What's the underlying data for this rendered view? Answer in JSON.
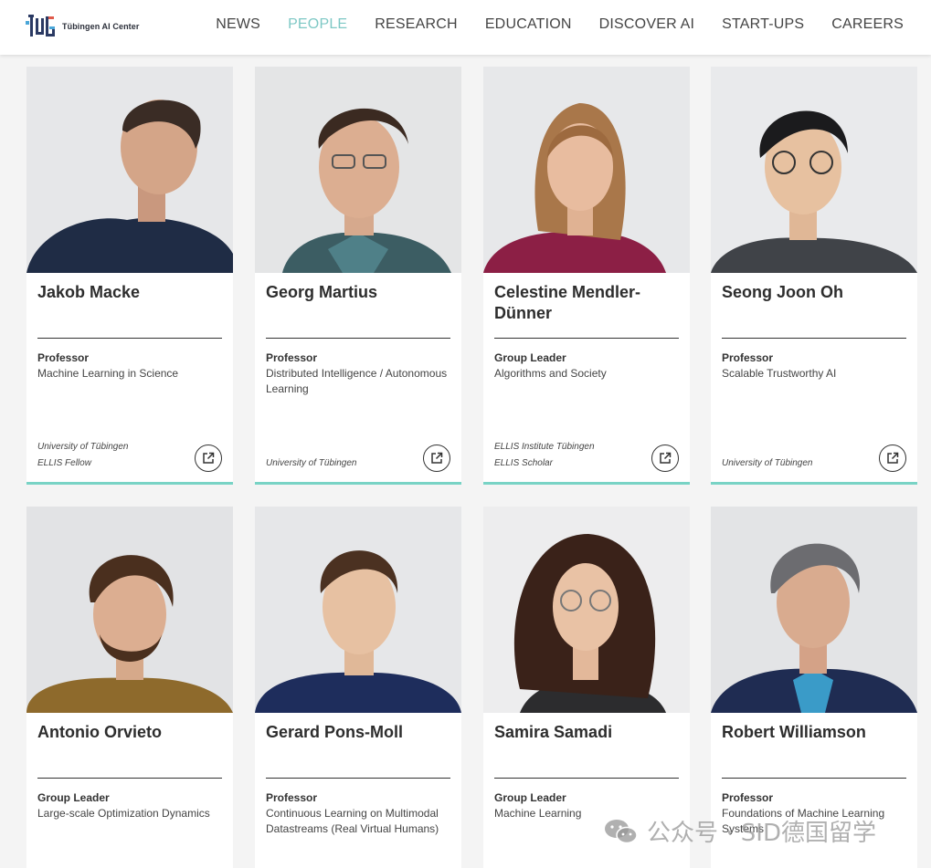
{
  "header": {
    "logo_text": "Tübingen AI Center",
    "nav": [
      "NEWS",
      "PEOPLE",
      "RESEARCH",
      "EDUCATION",
      "DISCOVER AI",
      "START-UPS",
      "CAREERS"
    ],
    "active_nav": "PEOPLE",
    "accent_color": "#7ec8c5"
  },
  "people": [
    {
      "name": "Jakob Macke",
      "role": "Professor",
      "field": "Machine Learning in Science",
      "affiliations": [
        "University of Tübingen",
        "ELLIS Fellow"
      ]
    },
    {
      "name": "Georg Martius",
      "role": "Professor",
      "field": "Distributed Intelligence / Autonomous Learning",
      "affiliations": [
        "University of Tübingen"
      ]
    },
    {
      "name": "Celestine Mendler-Dünner",
      "role": "Group Leader",
      "field": "Algorithms and Society",
      "affiliations": [
        "ELLIS Institute Tübingen",
        "ELLIS Scholar"
      ]
    },
    {
      "name": "Seong Joon Oh",
      "role": "Professor",
      "field": "Scalable Trustworthy AI",
      "affiliations": [
        "University of Tübingen"
      ]
    },
    {
      "name": "Antonio Orvieto",
      "role": "Group Leader",
      "field": "Large-scale Optimization Dynamics",
      "affiliations": []
    },
    {
      "name": "Gerard Pons-Moll",
      "role": "Professor",
      "field": "Continuous Learning on Multimodal Datastreams (Real Virtual Humans)",
      "affiliations": []
    },
    {
      "name": "Samira Samadi",
      "role": "Group Leader",
      "field": "Machine Learning",
      "affiliations": []
    },
    {
      "name": "Robert Williamson",
      "role": "Professor",
      "field": "Foundations of Machine Learning Systems",
      "affiliations": []
    }
  ],
  "card_accent_color": "#78d3c5",
  "external_link_icon": "external-link-icon",
  "watermark": "公众号 · SID德国留学"
}
